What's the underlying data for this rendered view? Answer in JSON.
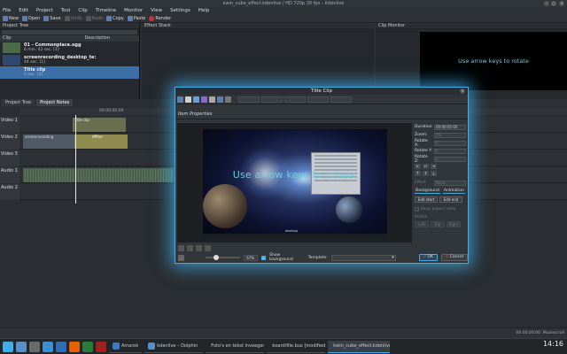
{
  "window": {
    "title": "kwin_cube_effect.kdenlive / HD 720p 30 fps – Kdenlive"
  },
  "menu": [
    "File",
    "Edit",
    "Project",
    "Tool",
    "Clip",
    "Timeline",
    "Monitor",
    "View",
    "Settings",
    "Help"
  ],
  "toolbar": {
    "new": "New",
    "open": "Open",
    "save": "Save",
    "undo": "Undo",
    "redo": "Redo",
    "copy": "Copy",
    "paste": "Paste",
    "render": "Render"
  },
  "project_tree": {
    "title": "Project Tree",
    "columns": [
      "Clip",
      "Description"
    ],
    "clips": [
      {
        "name": "01 - Commonplace.ogg",
        "info": "6 min. 42 sec. [1]"
      },
      {
        "name": "screenrecording_desktop_te:",
        "info": "44 sec. [1]"
      },
      {
        "name": "Title clip",
        "info": "5 sec. [1]"
      }
    ]
  },
  "effect_stack": {
    "title": "Effect Stack"
  },
  "clip_monitor": {
    "title": "Clip Monitor",
    "screen_text": "Use arrow keys to rotate"
  },
  "bottom_tabs": [
    "Project Tree",
    "Project Notes"
  ],
  "timeline": {
    "ruler_start": "00:00:00:00",
    "tracks": [
      "Video 1",
      "Video 2",
      "Video 3",
      "Audio 1",
      "Audio 2"
    ],
    "clip_labels": {
      "title_clip": "Title clip",
      "video_clip": "screenrecording",
      "effect": "Affine"
    }
  },
  "status": {
    "timecode": "00:00:00:00",
    "zoom": "Muonscroll"
  },
  "taskbar": {
    "tasks": [
      "Amarok",
      "kdenlive – Dolphin",
      "Foto's en tekst invoegen",
      "board/file.bux [modified]",
      "kwin_cube_effect.kdenlive"
    ],
    "clock": "14:16"
  },
  "dialog": {
    "title": "Title Clip",
    "section": "Item Properties",
    "title_text": "Use arrow keys to rotate",
    "screen_label": "desktop",
    "props": {
      "duration_label": "Duration",
      "duration_value": "00:00:05:00",
      "zoom_label": "Zoom:",
      "zoom_value": "0%",
      "rotx_label": "Rotate X:",
      "rotx_value": "0",
      "roty_label": "Rotate Y:",
      "roty_value": "0",
      "rotz_label": "Rotate Z:",
      "rotz_value": "0",
      "effect_label": "Effect",
      "effect_value": "None",
      "tab_background": "Background",
      "tab_animation": "Animation",
      "edit_start": "Edit start",
      "edit_end": "Edit end",
      "keep_aspect": "Keep aspect ratio",
      "resize": "Resize",
      "left_btn": "Left",
      "top_btn": "Top",
      "right_btn": "Right"
    },
    "bottom": {
      "zoom_percent": "67%",
      "show_background": "Show background",
      "template_label": "Template:",
      "ok": "OK",
      "cancel": "Cancel"
    }
  },
  "colors": {
    "accent": "#3daee9",
    "title_text": "#5fd3e0",
    "selection": "#3c6ea8"
  }
}
